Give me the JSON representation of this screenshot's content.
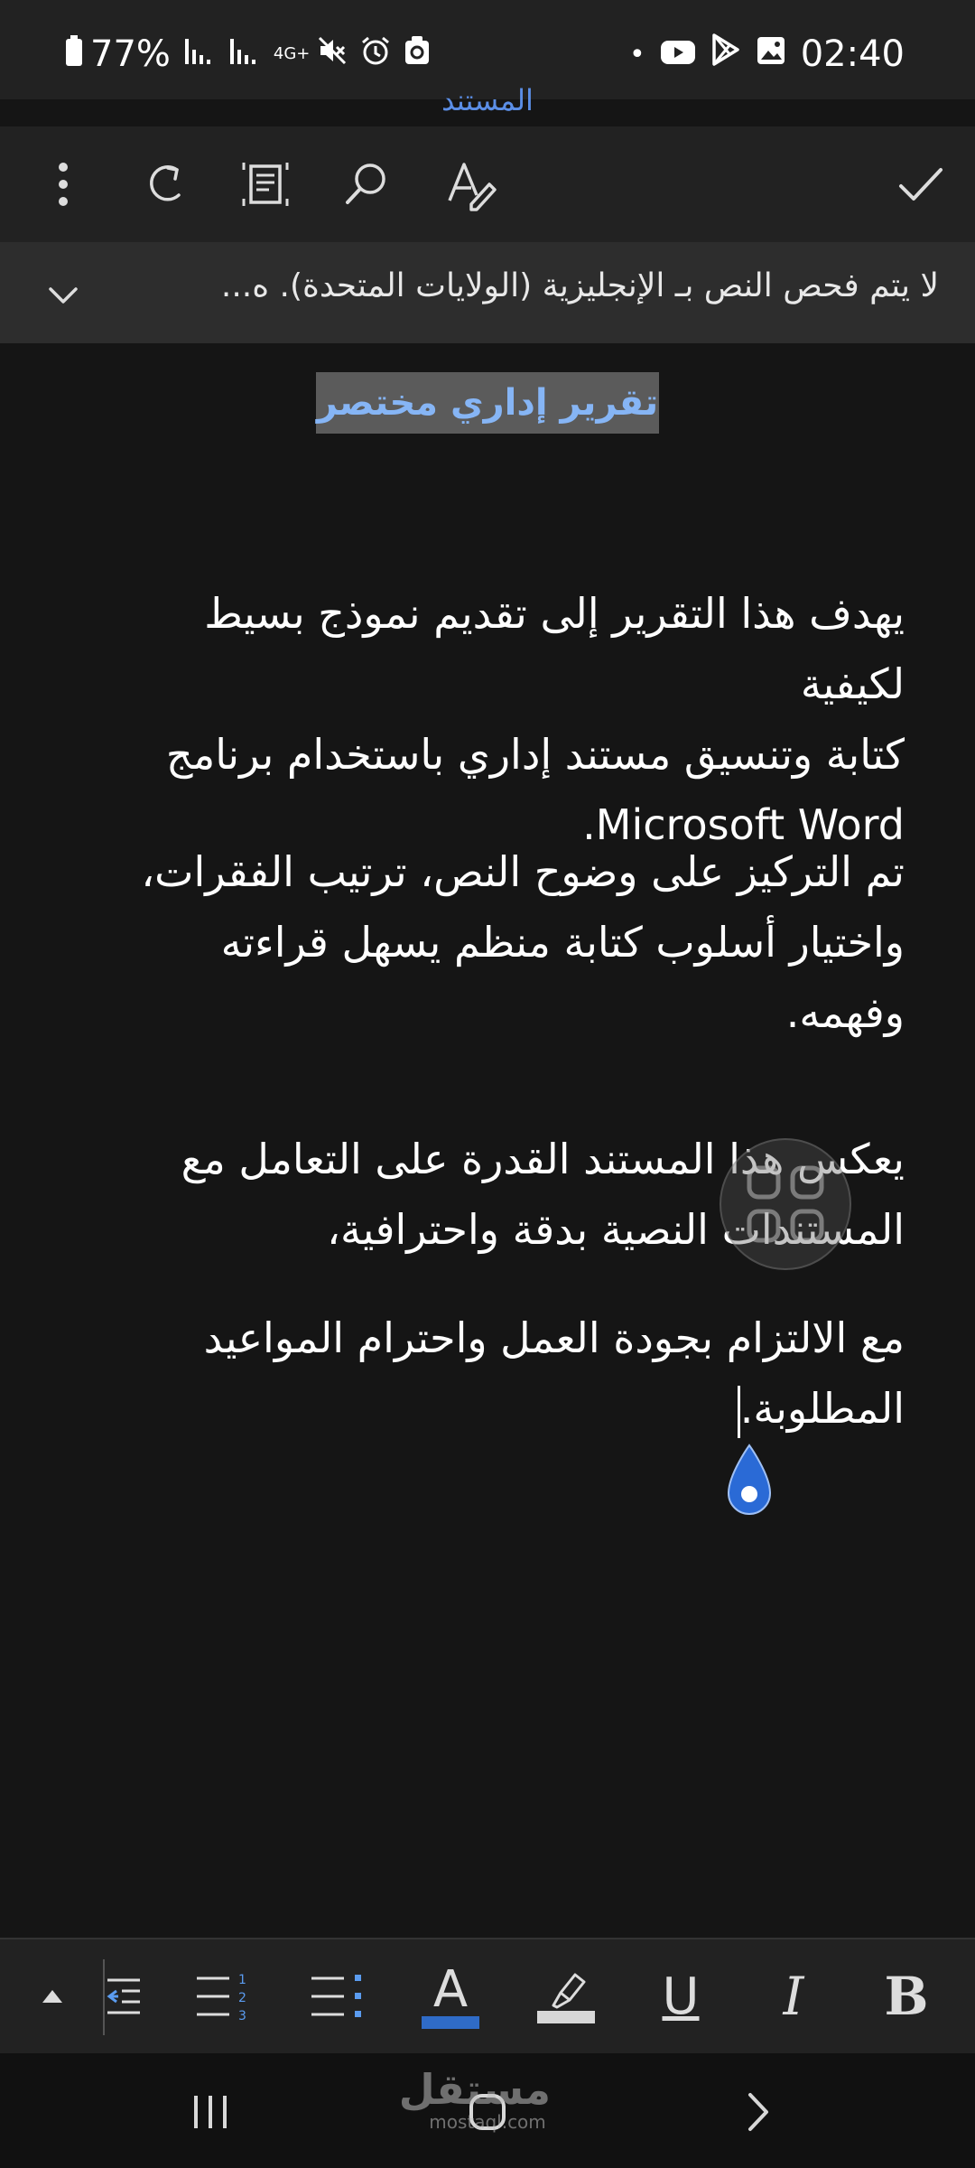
{
  "status_bar": {
    "battery": "77%",
    "network": "4G+",
    "time": "02:40",
    "dot": "•",
    "left_icons": [
      "battery-icon",
      "signal-icon-1",
      "signal-icon-2",
      "network-4g-icon",
      "mute-icon",
      "alarm-icon",
      "recycle-icon"
    ],
    "right_icons": [
      "youtube-icon",
      "play-store-icon",
      "gallery-icon"
    ]
  },
  "app": {
    "document_label": "المستند"
  },
  "toolbar": {
    "buttons": [
      "more-options",
      "redo",
      "read-mode",
      "search",
      "editor",
      "done"
    ]
  },
  "notice": {
    "text": "لا يتم فحص النص بـ الإنجليزية (الولايات المتحدة). ه...",
    "expand_icon": "chevron-down-icon"
  },
  "document": {
    "title": "تقرير إداري مختصر",
    "paragraphs": [
      [
        "يهدف هذا التقرير إلى تقديم نموذج بسيط لكيفية",
        "كتابة وتنسيق مستند إداري باستخدام برنامج",
        "Microsoft Word."
      ],
      [
        "تم التركيز على وضوح النص، ترتيب الفقرات،",
        "واختيار أسلوب كتابة منظم يسهل قراءته وفهمه."
      ],
      [
        "يعكس هذا المستند القدرة على التعامل مع",
        "المستندات النصية بدقة واحترافية،"
      ],
      [
        "مع الالتزام بجودة العمل واحترام المواعيد",
        "المطلوبة."
      ]
    ]
  },
  "format_bar": {
    "buttons": [
      "expand-up",
      "decrease-indent",
      "numbered-list",
      "bullet-list",
      "font-color",
      "highlight",
      "underline",
      "italic",
      "bold"
    ],
    "font_color_letter": "A",
    "underline_letter": "U",
    "italic_letter": "I",
    "bold_letter": "B",
    "colors": {
      "font_color_bar": "#2f6bc7",
      "highlight_bar": "#d8d8d8",
      "accent": "#5b8ee6"
    }
  },
  "nav_bar": {
    "watermark_main": "مستقل",
    "watermark_sub": "mostaql.com"
  }
}
